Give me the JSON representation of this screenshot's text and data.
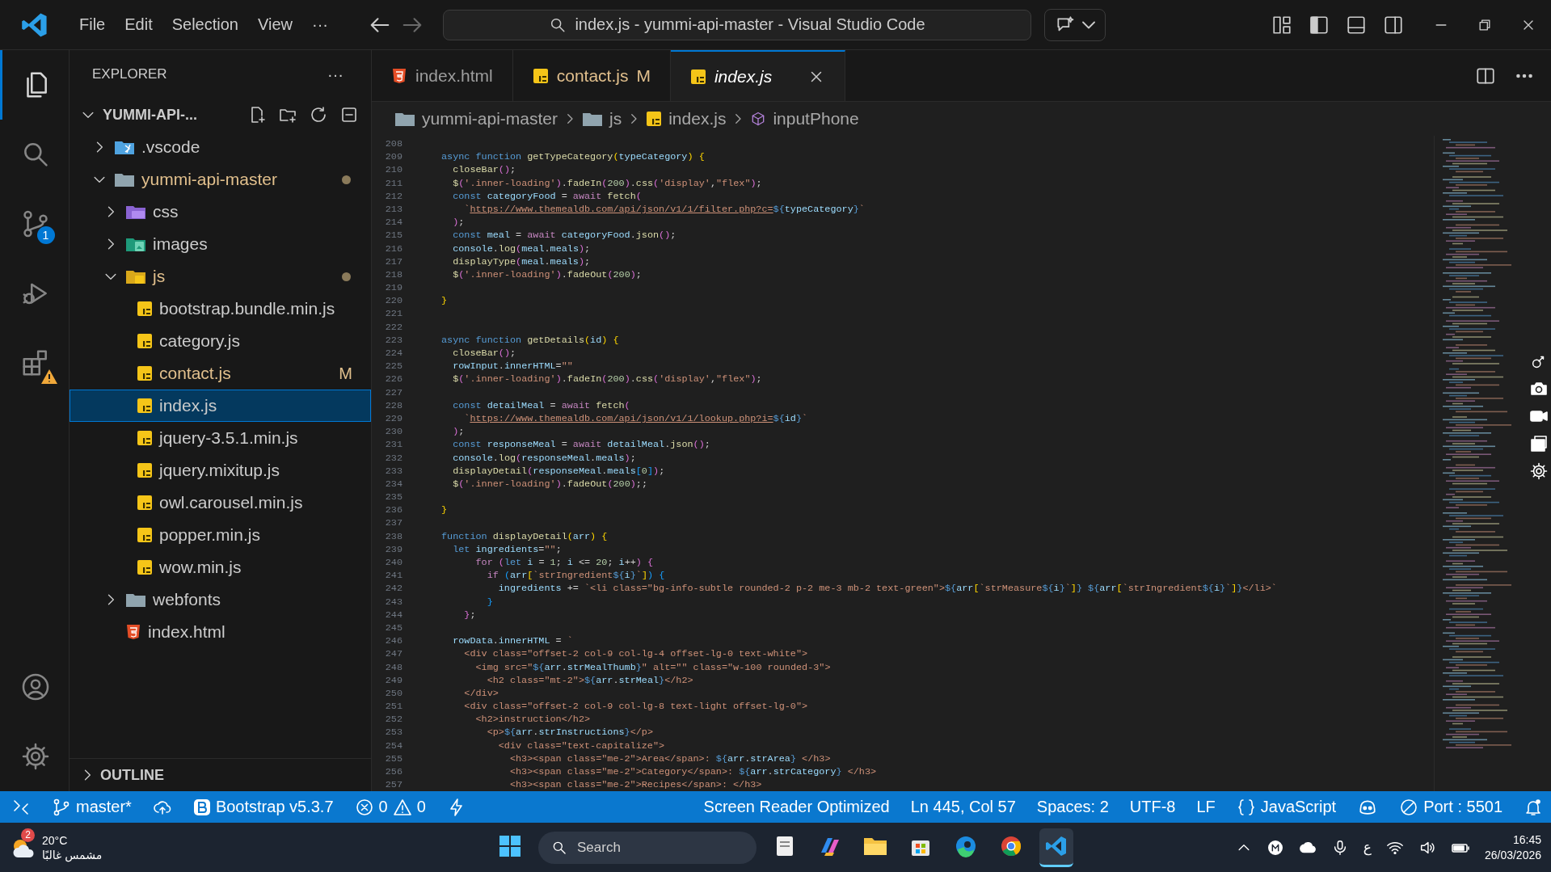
{
  "title_bar": {
    "menu": [
      "File",
      "Edit",
      "Selection",
      "View"
    ],
    "more": "···",
    "command_center": "index.js - yummi-api-master - Visual Studio Code",
    "back_disabled": false,
    "forward_disabled": true
  },
  "activity_bar": [
    {
      "kind": "explorer",
      "selected": true
    },
    {
      "kind": "search",
      "selected": false
    },
    {
      "kind": "source-control",
      "selected": false,
      "badge": "1"
    },
    {
      "kind": "run",
      "selected": false
    },
    {
      "kind": "extensions",
      "selected": false,
      "warning": true
    },
    {
      "kind": "account",
      "selected": false
    },
    {
      "kind": "settings",
      "selected": false
    }
  ],
  "sidebar": {
    "title": "EXPLORER",
    "more": "···",
    "tree": [
      {
        "label": "YUMMI-API-...",
        "kind": "root",
        "expanded": true,
        "modified": false,
        "selected": false,
        "children": [
          {
            "label": ".vscode",
            "kind": "vscode",
            "expanded": false,
            "modified": false,
            "selected": false
          },
          {
            "label": "yummi-api-master",
            "kind": "folder",
            "expanded": true,
            "modified": true,
            "selected": false,
            "children": [
              {
                "label": "css",
                "kind": "css",
                "expanded": false,
                "modified": false,
                "selected": false
              },
              {
                "label": "images",
                "kind": "images",
                "expanded": false,
                "modified": false,
                "selected": false
              },
              {
                "label": "js",
                "kind": "js-folder",
                "expanded": true,
                "modified": true,
                "selected": false,
                "children": [
                  {
                    "label": "bootstrap.bundle.min.js",
                    "kind": "js",
                    "modified": false,
                    "selected": false
                  },
                  {
                    "label": "category.js",
                    "kind": "js",
                    "modified": false,
                    "selected": false
                  },
                  {
                    "label": "contact.js",
                    "kind": "js",
                    "modified": true,
                    "badge": "M",
                    "selected": false
                  },
                  {
                    "label": "index.js",
                    "kind": "js",
                    "modified": false,
                    "selected": true
                  },
                  {
                    "label": "jquery-3.5.1.min.js",
                    "kind": "js",
                    "modified": false,
                    "selected": false
                  },
                  {
                    "label": "jquery.mixitup.js",
                    "kind": "js",
                    "modified": false,
                    "selected": false
                  },
                  {
                    "label": "owl.carousel.min.js",
                    "kind": "js",
                    "modified": false,
                    "selected": false
                  },
                  {
                    "label": "popper.min.js",
                    "kind": "js",
                    "modified": false,
                    "selected": false
                  },
                  {
                    "label": "wow.min.js",
                    "kind": "js",
                    "modified": false,
                    "selected": false
                  }
                ]
              },
              {
                "label": "webfonts",
                "kind": "folder",
                "expanded": false,
                "modified": false,
                "selected": false
              },
              {
                "label": "index.html",
                "kind": "html",
                "modified": false,
                "selected": false
              }
            ]
          }
        ]
      }
    ],
    "outline": {
      "label": "OUTLINE",
      "expanded": false
    }
  },
  "tabs": [
    {
      "label": "index.html",
      "kind": "html",
      "selected": false,
      "modified": false,
      "preview": false
    },
    {
      "label": "contact.js",
      "kind": "js",
      "selected": false,
      "modified": true,
      "badge": "M",
      "preview": false
    },
    {
      "label": "index.js",
      "kind": "js",
      "selected": true,
      "modified": false,
      "preview": true
    }
  ],
  "breadcrumb": [
    {
      "label": "yummi-api-master",
      "kind": "folder"
    },
    {
      "label": "js",
      "kind": "folder"
    },
    {
      "label": "index.js",
      "kind": "js"
    },
    {
      "label": "inputPhone",
      "kind": "symbol"
    }
  ],
  "editor": {
    "lines": [
      {
        "number": "208"
      },
      {
        "number": "209",
        "tokens": [
          {
            "kind": "k",
            "text": "async function "
          },
          {
            "kind": "f",
            "text": "getTypeCategory"
          },
          {
            "kind": "b1",
            "text": "("
          },
          {
            "kind": "v",
            "text": "typeCategory"
          },
          {
            "kind": "b1",
            "text": ")"
          },
          {
            "kind": "b1",
            "text": " {"
          }
        ]
      },
      {
        "number": "210",
        "tokens": [
          {
            "kind": "f",
            "text": "  closeBar"
          },
          {
            "kind": "b2",
            "text": "()"
          },
          {
            "kind": "p",
            "text": ";"
          }
        ]
      },
      {
        "number": "211",
        "tokens": [
          {
            "kind": "f",
            "text": "  $"
          },
          {
            "kind": "b2",
            "text": "("
          },
          {
            "kind": "s",
            "text": "'.inner-loading'"
          },
          {
            "kind": "b2",
            "text": ")"
          },
          {
            "kind": "p",
            "text": "."
          },
          {
            "kind": "f",
            "text": "fadeIn"
          },
          {
            "kind": "b2",
            "text": "("
          },
          {
            "kind": "n",
            "text": "200"
          },
          {
            "kind": "b2",
            "text": ")"
          },
          {
            "kind": "p",
            "text": "."
          },
          {
            "kind": "f",
            "text": "css"
          },
          {
            "kind": "b2",
            "text": "("
          },
          {
            "kind": "s",
            "text": "'display'"
          },
          {
            "kind": "p",
            "text": ","
          },
          {
            "kind": "s",
            "text": "\"flex\""
          },
          {
            "kind": "b2",
            "text": ")"
          },
          {
            "kind": "p",
            "text": ";"
          }
        ]
      },
      {
        "number": "212",
        "tokens": [
          {
            "kind": "k",
            "text": "  const "
          },
          {
            "kind": "v",
            "text": "categoryFood"
          },
          {
            "kind": "p",
            "text": " = "
          },
          {
            "kind": "c",
            "text": "await "
          },
          {
            "kind": "f",
            "text": "fetch"
          },
          {
            "kind": "b2",
            "text": "("
          }
        ]
      },
      {
        "number": "213",
        "tokens": [
          {
            "kind": "s",
            "text": "    `"
          },
          {
            "kind": "u",
            "text": "https://www.themealdb.com/api/json/v1/1/filter.php?c="
          },
          {
            "kind": "t",
            "text": "${"
          },
          {
            "kind": "v",
            "text": "typeCategory"
          },
          {
            "kind": "t",
            "text": "}"
          },
          {
            "kind": "s",
            "text": "`"
          }
        ]
      },
      {
        "number": "214",
        "tokens": [
          {
            "kind": "b2",
            "text": "  )"
          },
          {
            "kind": "p",
            "text": ";"
          }
        ]
      },
      {
        "number": "215",
        "tokens": [
          {
            "kind": "k",
            "text": "  const "
          },
          {
            "kind": "v",
            "text": "meal"
          },
          {
            "kind": "p",
            "text": " = "
          },
          {
            "kind": "c",
            "text": "await "
          },
          {
            "kind": "v",
            "text": "categoryFood"
          },
          {
            "kind": "p",
            "text": "."
          },
          {
            "kind": "f",
            "text": "json"
          },
          {
            "kind": "b2",
            "text": "()"
          },
          {
            "kind": "p",
            "text": ";"
          }
        ]
      },
      {
        "number": "216",
        "tokens": [
          {
            "kind": "v",
            "text": "  console"
          },
          {
            "kind": "p",
            "text": "."
          },
          {
            "kind": "f",
            "text": "log"
          },
          {
            "kind": "b2",
            "text": "("
          },
          {
            "kind": "v",
            "text": "meal"
          },
          {
            "kind": "p",
            "text": "."
          },
          {
            "kind": "v",
            "text": "meals"
          },
          {
            "kind": "b2",
            "text": ")"
          },
          {
            "kind": "p",
            "text": ";"
          }
        ]
      },
      {
        "number": "217",
        "tokens": [
          {
            "kind": "f",
            "text": "  displayType"
          },
          {
            "kind": "b2",
            "text": "("
          },
          {
            "kind": "v",
            "text": "meal"
          },
          {
            "kind": "p",
            "text": "."
          },
          {
            "kind": "v",
            "text": "meals"
          },
          {
            "kind": "b2",
            "text": ")"
          },
          {
            "kind": "p",
            "text": ";"
          }
        ]
      },
      {
        "number": "218",
        "tokens": [
          {
            "kind": "f",
            "text": "  $"
          },
          {
            "kind": "b2",
            "text": "("
          },
          {
            "kind": "s",
            "text": "'.inner-loading'"
          },
          {
            "kind": "b2",
            "text": ")"
          },
          {
            "kind": "p",
            "text": "."
          },
          {
            "kind": "f",
            "text": "fadeOut"
          },
          {
            "kind": "b2",
            "text": "("
          },
          {
            "kind": "n",
            "text": "200"
          },
          {
            "kind": "b2",
            "text": ")"
          },
          {
            "kind": "p",
            "text": ";"
          }
        ]
      },
      {
        "number": "219"
      },
      {
        "number": "220",
        "tokens": [
          {
            "kind": "b1",
            "text": "}"
          }
        ]
      },
      {
        "number": "221"
      },
      {
        "number": "222"
      },
      {
        "number": "223",
        "tokens": [
          {
            "kind": "k",
            "text": "async function "
          },
          {
            "kind": "f",
            "text": "getDetails"
          },
          {
            "kind": "b1",
            "text": "("
          },
          {
            "kind": "v",
            "text": "id"
          },
          {
            "kind": "b1",
            "text": ")"
          },
          {
            "kind": "b1",
            "text": " {"
          }
        ]
      },
      {
        "number": "224",
        "tokens": [
          {
            "kind": "f",
            "text": "  closeBar"
          },
          {
            "kind": "b2",
            "text": "()"
          },
          {
            "kind": "p",
            "text": ";"
          }
        ]
      },
      {
        "number": "225",
        "tokens": [
          {
            "kind": "v",
            "text": "  rowInput"
          },
          {
            "kind": "p",
            "text": "."
          },
          {
            "kind": "v",
            "text": "innerHTML"
          },
          {
            "kind": "p",
            "text": "="
          },
          {
            "kind": "s",
            "text": "\"\""
          }
        ]
      },
      {
        "number": "226",
        "tokens": [
          {
            "kind": "f",
            "text": "  $"
          },
          {
            "kind": "b2",
            "text": "("
          },
          {
            "kind": "s",
            "text": "'.inner-loading'"
          },
          {
            "kind": "b2",
            "text": ")"
          },
          {
            "kind": "p",
            "text": "."
          },
          {
            "kind": "f",
            "text": "fadeIn"
          },
          {
            "kind": "b2",
            "text": "("
          },
          {
            "kind": "n",
            "text": "200"
          },
          {
            "kind": "b2",
            "text": ")"
          },
          {
            "kind": "p",
            "text": "."
          },
          {
            "kind": "f",
            "text": "css"
          },
          {
            "kind": "b2",
            "text": "("
          },
          {
            "kind": "s",
            "text": "'display'"
          },
          {
            "kind": "p",
            "text": ","
          },
          {
            "kind": "s",
            "text": "\"flex\""
          },
          {
            "kind": "b2",
            "text": ")"
          },
          {
            "kind": "p",
            "text": ";"
          }
        ]
      },
      {
        "number": "227"
      },
      {
        "number": "228",
        "tokens": [
          {
            "kind": "k",
            "text": "  const "
          },
          {
            "kind": "v",
            "text": "detailMeal"
          },
          {
            "kind": "p",
            "text": " = "
          },
          {
            "kind": "c",
            "text": "await "
          },
          {
            "kind": "f",
            "text": "fetch"
          },
          {
            "kind": "b2",
            "text": "("
          }
        ]
      },
      {
        "number": "229",
        "tokens": [
          {
            "kind": "s",
            "text": "    `"
          },
          {
            "kind": "u",
            "text": "https://www.themealdb.com/api/json/v1/1/lookup.php?i="
          },
          {
            "kind": "t",
            "text": "${"
          },
          {
            "kind": "v",
            "text": "id"
          },
          {
            "kind": "t",
            "text": "}"
          },
          {
            "kind": "s",
            "text": "`"
          }
        ]
      },
      {
        "number": "230",
        "tokens": [
          {
            "kind": "b2",
            "text": "  )"
          },
          {
            "kind": "p",
            "text": ";"
          }
        ]
      },
      {
        "number": "231",
        "tokens": [
          {
            "kind": "k",
            "text": "  const "
          },
          {
            "kind": "v",
            "text": "responseMeal"
          },
          {
            "kind": "p",
            "text": " = "
          },
          {
            "kind": "c",
            "text": "await "
          },
          {
            "kind": "v",
            "text": "detailMeal"
          },
          {
            "kind": "p",
            "text": "."
          },
          {
            "kind": "f",
            "text": "json"
          },
          {
            "kind": "b2",
            "text": "()"
          },
          {
            "kind": "p",
            "text": ";"
          }
        ]
      },
      {
        "number": "232",
        "tokens": [
          {
            "kind": "v",
            "text": "  console"
          },
          {
            "kind": "p",
            "text": "."
          },
          {
            "kind": "f",
            "text": "log"
          },
          {
            "kind": "b2",
            "text": "("
          },
          {
            "kind": "v",
            "text": "responseMeal"
          },
          {
            "kind": "p",
            "text": "."
          },
          {
            "kind": "v",
            "text": "meals"
          },
          {
            "kind": "b2",
            "text": ")"
          },
          {
            "kind": "p",
            "text": ";"
          }
        ]
      },
      {
        "number": "233",
        "tokens": [
          {
            "kind": "f",
            "text": "  displayDetail"
          },
          {
            "kind": "b2",
            "text": "("
          },
          {
            "kind": "v",
            "text": "responseMeal"
          },
          {
            "kind": "p",
            "text": "."
          },
          {
            "kind": "v",
            "text": "meals"
          },
          {
            "kind": "b3",
            "text": "["
          },
          {
            "kind": "n",
            "text": "0"
          },
          {
            "kind": "b3",
            "text": "]"
          },
          {
            "kind": "b2",
            "text": ")"
          },
          {
            "kind": "p",
            "text": ";"
          }
        ]
      },
      {
        "number": "234",
        "tokens": [
          {
            "kind": "f",
            "text": "  $"
          },
          {
            "kind": "b2",
            "text": "("
          },
          {
            "kind": "s",
            "text": "'.inner-loading'"
          },
          {
            "kind": "b2",
            "text": ")"
          },
          {
            "kind": "p",
            "text": "."
          },
          {
            "kind": "f",
            "text": "fadeOut"
          },
          {
            "kind": "b2",
            "text": "("
          },
          {
            "kind": "n",
            "text": "200"
          },
          {
            "kind": "b2",
            "text": ")"
          },
          {
            "kind": "p",
            "text": ";;"
          }
        ]
      },
      {
        "number": "235"
      },
      {
        "number": "236",
        "tokens": [
          {
            "kind": "b1",
            "text": "}"
          }
        ]
      },
      {
        "number": "237"
      },
      {
        "number": "238",
        "tokens": [
          {
            "kind": "k",
            "text": "function "
          },
          {
            "kind": "f",
            "text": "displayDetail"
          },
          {
            "kind": "b1",
            "text": "("
          },
          {
            "kind": "v",
            "text": "arr"
          },
          {
            "kind": "b1",
            "text": ")"
          },
          {
            "kind": "b1",
            "text": " {"
          }
        ]
      },
      {
        "number": "239",
        "tokens": [
          {
            "kind": "k",
            "text": "  let "
          },
          {
            "kind": "v",
            "text": "ingredients"
          },
          {
            "kind": "p",
            "text": "="
          },
          {
            "kind": "s",
            "text": "\"\""
          },
          {
            "kind": "p",
            "text": ";"
          }
        ]
      },
      {
        "number": "240",
        "tokens": [
          {
            "kind": "c",
            "text": "      for "
          },
          {
            "kind": "b2",
            "text": "("
          },
          {
            "kind": "k",
            "text": "let "
          },
          {
            "kind": "v",
            "text": "i"
          },
          {
            "kind": "p",
            "text": " = "
          },
          {
            "kind": "n",
            "text": "1"
          },
          {
            "kind": "p",
            "text": "; "
          },
          {
            "kind": "v",
            "text": "i"
          },
          {
            "kind": "p",
            "text": " <= "
          },
          {
            "kind": "n",
            "text": "20"
          },
          {
            "kind": "p",
            "text": "; "
          },
          {
            "kind": "v",
            "text": "i"
          },
          {
            "kind": "p",
            "text": "++"
          },
          {
            "kind": "b2",
            "text": ")"
          },
          {
            "kind": "b2",
            "text": " {"
          }
        ]
      },
      {
        "number": "241",
        "tokens": [
          {
            "kind": "c",
            "text": "        if "
          },
          {
            "kind": "b3",
            "text": "("
          },
          {
            "kind": "v",
            "text": "arr"
          },
          {
            "kind": "b1",
            "text": "["
          },
          {
            "kind": "s",
            "text": "`strIngredient"
          },
          {
            "kind": "t",
            "text": "${"
          },
          {
            "kind": "v",
            "text": "i"
          },
          {
            "kind": "t",
            "text": "}"
          },
          {
            "kind": "s",
            "text": "`"
          },
          {
            "kind": "b1",
            "text": "]"
          },
          {
            "kind": "b3",
            "text": ")"
          },
          {
            "kind": "b3",
            "text": " {"
          }
        ]
      },
      {
        "number": "242",
        "tokens": [
          {
            "kind": "v",
            "text": "          ingredients"
          },
          {
            "kind": "p",
            "text": " += "
          },
          {
            "kind": "s",
            "text": "`<li class=\"bg-info-subtle rounded-2 p-2 me-3 mb-2 text-green\">"
          },
          {
            "kind": "t",
            "text": "${"
          },
          {
            "kind": "v",
            "text": "arr"
          },
          {
            "kind": "b1",
            "text": "["
          },
          {
            "kind": "s",
            "text": "`strMeasure"
          },
          {
            "kind": "t",
            "text": "${"
          },
          {
            "kind": "v",
            "text": "i"
          },
          {
            "kind": "t",
            "text": "}"
          },
          {
            "kind": "s",
            "text": "`"
          },
          {
            "kind": "b1",
            "text": "]"
          },
          {
            "kind": "t",
            "text": "}"
          },
          {
            "kind": "t",
            "text": " ${"
          },
          {
            "kind": "v",
            "text": "arr"
          },
          {
            "kind": "b1",
            "text": "["
          },
          {
            "kind": "s",
            "text": "`strIngredient"
          },
          {
            "kind": "t",
            "text": "${"
          },
          {
            "kind": "v",
            "text": "i"
          },
          {
            "kind": "t",
            "text": "}"
          },
          {
            "kind": "s",
            "text": "`"
          },
          {
            "kind": "b1",
            "text": "]"
          },
          {
            "kind": "t",
            "text": "}"
          },
          {
            "kind": "s",
            "text": "</li>`"
          }
        ]
      },
      {
        "number": "243",
        "tokens": [
          {
            "kind": "b3",
            "text": "        }"
          }
        ]
      },
      {
        "number": "244",
        "tokens": [
          {
            "kind": "b2",
            "text": "    }"
          },
          {
            "kind": "p",
            "text": ";"
          }
        ]
      },
      {
        "number": "245"
      },
      {
        "number": "246",
        "tokens": [
          {
            "kind": "v",
            "text": "  rowData"
          },
          {
            "kind": "p",
            "text": "."
          },
          {
            "kind": "v",
            "text": "innerHTML"
          },
          {
            "kind": "p",
            "text": " = "
          },
          {
            "kind": "s",
            "text": "`"
          }
        ]
      },
      {
        "number": "247",
        "tokens": [
          {
            "kind": "s",
            "text": "    <div class=\"offset-2 col-9 col-lg-4 offset-lg-0 text-white\">"
          }
        ]
      },
      {
        "number": "248",
        "tokens": [
          {
            "kind": "s",
            "text": "      <img src=\""
          },
          {
            "kind": "t",
            "text": "${"
          },
          {
            "kind": "v",
            "text": "arr"
          },
          {
            "kind": "p",
            "text": "."
          },
          {
            "kind": "v",
            "text": "strMealThumb"
          },
          {
            "kind": "t",
            "text": "}"
          },
          {
            "kind": "s",
            "text": "\" alt=\"\" class=\"w-100 rounded-3\">"
          }
        ]
      },
      {
        "number": "249",
        "tokens": [
          {
            "kind": "s",
            "text": "        <h2 class=\"mt-2\">"
          },
          {
            "kind": "t",
            "text": "${"
          },
          {
            "kind": "v",
            "text": "arr"
          },
          {
            "kind": "p",
            "text": "."
          },
          {
            "kind": "v",
            "text": "strMeal"
          },
          {
            "kind": "t",
            "text": "}"
          },
          {
            "kind": "s",
            "text": "</h2>"
          }
        ]
      },
      {
        "number": "250",
        "tokens": [
          {
            "kind": "s",
            "text": "    </div>"
          }
        ]
      },
      {
        "number": "251",
        "tokens": [
          {
            "kind": "s",
            "text": "    <div class=\"offset-2 col-9 col-lg-8 text-light offset-lg-0\">"
          }
        ]
      },
      {
        "number": "252",
        "tokens": [
          {
            "kind": "s",
            "text": "      <h2>instruction</h2>"
          }
        ]
      },
      {
        "number": "253",
        "tokens": [
          {
            "kind": "s",
            "text": "        <p>"
          },
          {
            "kind": "t",
            "text": "${"
          },
          {
            "kind": "v",
            "text": "arr"
          },
          {
            "kind": "p",
            "text": "."
          },
          {
            "kind": "v",
            "text": "strInstructions"
          },
          {
            "kind": "t",
            "text": "}"
          },
          {
            "kind": "s",
            "text": "</p>"
          }
        ]
      },
      {
        "number": "254",
        "tokens": [
          {
            "kind": "s",
            "text": "          <div class=\"text-capitalize\">"
          }
        ]
      },
      {
        "number": "255",
        "tokens": [
          {
            "kind": "s",
            "text": "            <h3><span class=\"me-2\">Area</span>: "
          },
          {
            "kind": "t",
            "text": "${"
          },
          {
            "kind": "v",
            "text": "arr"
          },
          {
            "kind": "p",
            "text": "."
          },
          {
            "kind": "v",
            "text": "strArea"
          },
          {
            "kind": "t",
            "text": "}"
          },
          {
            "kind": "s",
            "text": " </h3>"
          }
        ]
      },
      {
        "number": "256",
        "tokens": [
          {
            "kind": "s",
            "text": "            <h3><span class=\"me-2\">Category</span>: "
          },
          {
            "kind": "t",
            "text": "${"
          },
          {
            "kind": "v",
            "text": "arr"
          },
          {
            "kind": "p",
            "text": "."
          },
          {
            "kind": "v",
            "text": "strCategory"
          },
          {
            "kind": "t",
            "text": "}"
          },
          {
            "kind": "s",
            "text": " </h3>"
          }
        ]
      },
      {
        "number": "257",
        "tokens": [
          {
            "kind": "s",
            "text": "            <h3><span class=\"me-2\">Recipes</span>: </h3>"
          }
        ]
      }
    ]
  },
  "status_bar": [
    {
      "kind": "remote"
    },
    {
      "kind": "branch",
      "text": "master*"
    },
    {
      "kind": "sync"
    },
    {
      "kind": "bootstrap",
      "text": "Bootstrap v5.3.7"
    },
    {
      "kind": "problems",
      "errors": "0",
      "warnings": "0"
    },
    {
      "kind": "lightning"
    },
    {
      "kind": "spacer"
    },
    {
      "kind": "text",
      "text": "Screen Reader Optimized"
    },
    {
      "kind": "text",
      "text": "Ln 445, Col 57"
    },
    {
      "kind": "text",
      "text": "Spaces: 2"
    },
    {
      "kind": "text",
      "text": "UTF-8"
    },
    {
      "kind": "text",
      "text": "LF"
    },
    {
      "kind": "language",
      "text": "JavaScript"
    },
    {
      "kind": "copilot"
    },
    {
      "kind": "port",
      "text": "Port : 5501"
    },
    {
      "kind": "bell"
    }
  ],
  "taskbar": {
    "weather": {
      "badge": "2",
      "temperature": "20°C",
      "condition": "مشمس غالبًا"
    },
    "search": {
      "placeholder": "Search"
    },
    "apps": [
      {
        "kind": "start",
        "selected": false
      },
      {
        "kind": "search"
      },
      {
        "kind": "notes",
        "selected": false
      },
      {
        "kind": "copilot",
        "selected": false
      },
      {
        "kind": "explorer",
        "selected": false
      },
      {
        "kind": "store",
        "selected": false
      },
      {
        "kind": "edge",
        "selected": false
      },
      {
        "kind": "chrome",
        "selected": false
      },
      {
        "kind": "vscode",
        "selected": true
      }
    ],
    "tray": {
      "language": "ع",
      "time": "16:45",
      "date": "26/03/2026"
    }
  }
}
